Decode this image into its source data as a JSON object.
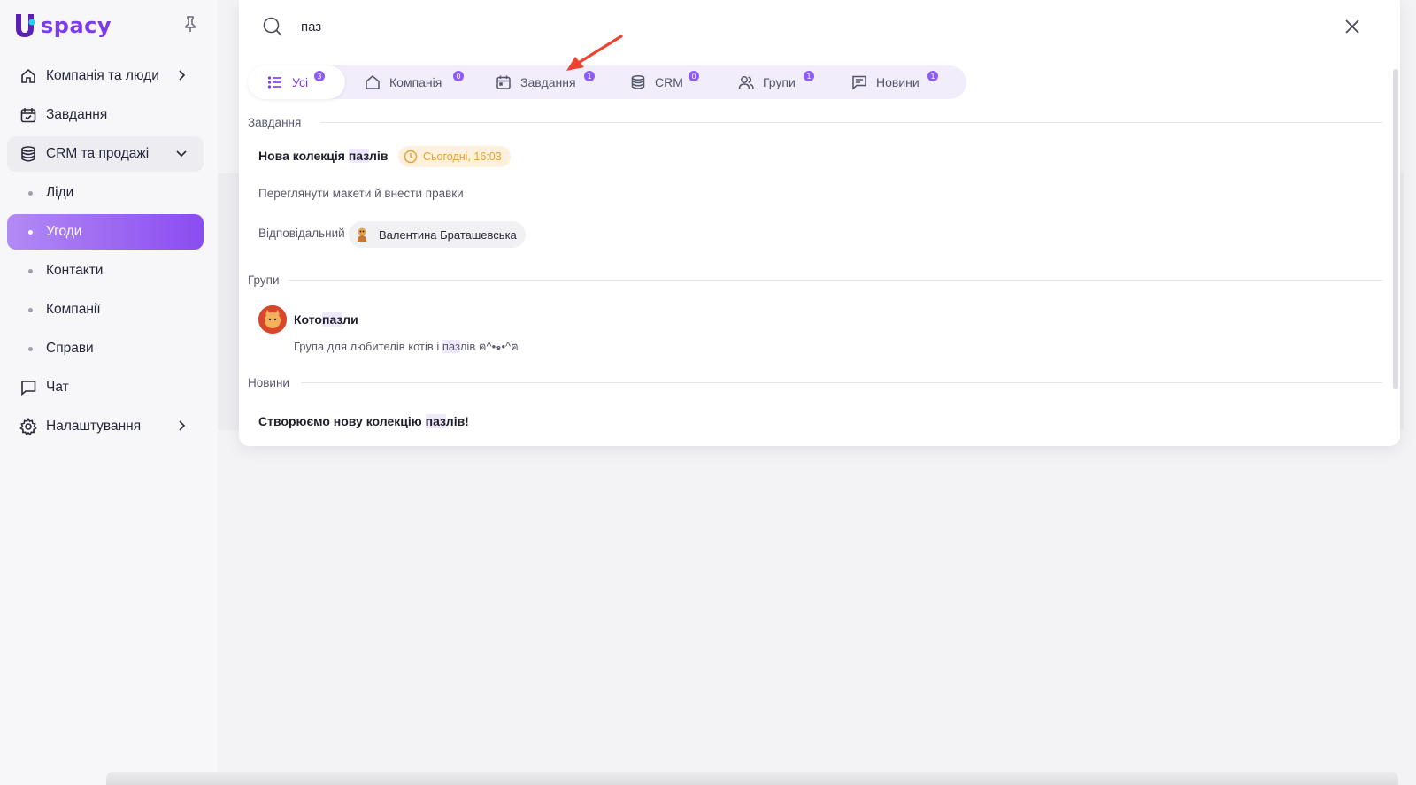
{
  "brand": {
    "name": "spacy",
    "accent": "#7c3aed",
    "active_gradient": [
      "#b28af5",
      "#8a4cf0"
    ]
  },
  "sidebar": {
    "pin_icon": "pin-icon",
    "items": [
      {
        "label": "Компанія та люди",
        "icon": "home-icon",
        "has_chevron": true
      },
      {
        "label": "Завдання",
        "icon": "calendar-check-icon"
      },
      {
        "label": "CRM та продажі",
        "icon": "database-icon",
        "expanded": true
      },
      {
        "label": "Чат",
        "icon": "chat-icon"
      },
      {
        "label": "Налаштування",
        "icon": "gear-icon",
        "has_chevron": true
      }
    ],
    "crm_sub": [
      {
        "label": "Ліди"
      },
      {
        "label": "Угоди",
        "active": true
      },
      {
        "label": "Контакти"
      },
      {
        "label": "Компанії"
      },
      {
        "label": "Справи"
      }
    ]
  },
  "search": {
    "query": "паз",
    "tabs": [
      {
        "label": "Усі",
        "count": "3",
        "active": true,
        "icon": "list-icon"
      },
      {
        "label": "Компанія",
        "count": "0",
        "icon": "home-icon"
      },
      {
        "label": "Завдання",
        "count": "1",
        "icon": "calendar-icon"
      },
      {
        "label": "CRM",
        "count": "0",
        "icon": "database-icon"
      },
      {
        "label": "Групи",
        "count": "1",
        "icon": "users-icon"
      },
      {
        "label": "Новини",
        "count": "1",
        "icon": "message-icon"
      }
    ]
  },
  "results": {
    "tasks": {
      "section": "Завдання",
      "title_pre": "Нова колекція ",
      "title_hl": "паз",
      "title_post": "лів",
      "due": "Сьогодні, 16:03",
      "description": "Переглянути макети й внести правки",
      "responsible_label": "Відповідальний",
      "responsible_name": "Валентина Браташевська"
    },
    "groups": {
      "section": "Групи",
      "name_pre": "Кото",
      "name_hl": "паз",
      "name_post": "ли",
      "desc_pre": "Група для любителів котів і ",
      "desc_hl": "паз",
      "desc_post": "лів ฅ^•ﻌ•^ฅ"
    },
    "news": {
      "section": "Новини",
      "title_pre": "Створюємо нову колекцію ",
      "title_hl": "паз",
      "title_post": "лів!"
    }
  }
}
